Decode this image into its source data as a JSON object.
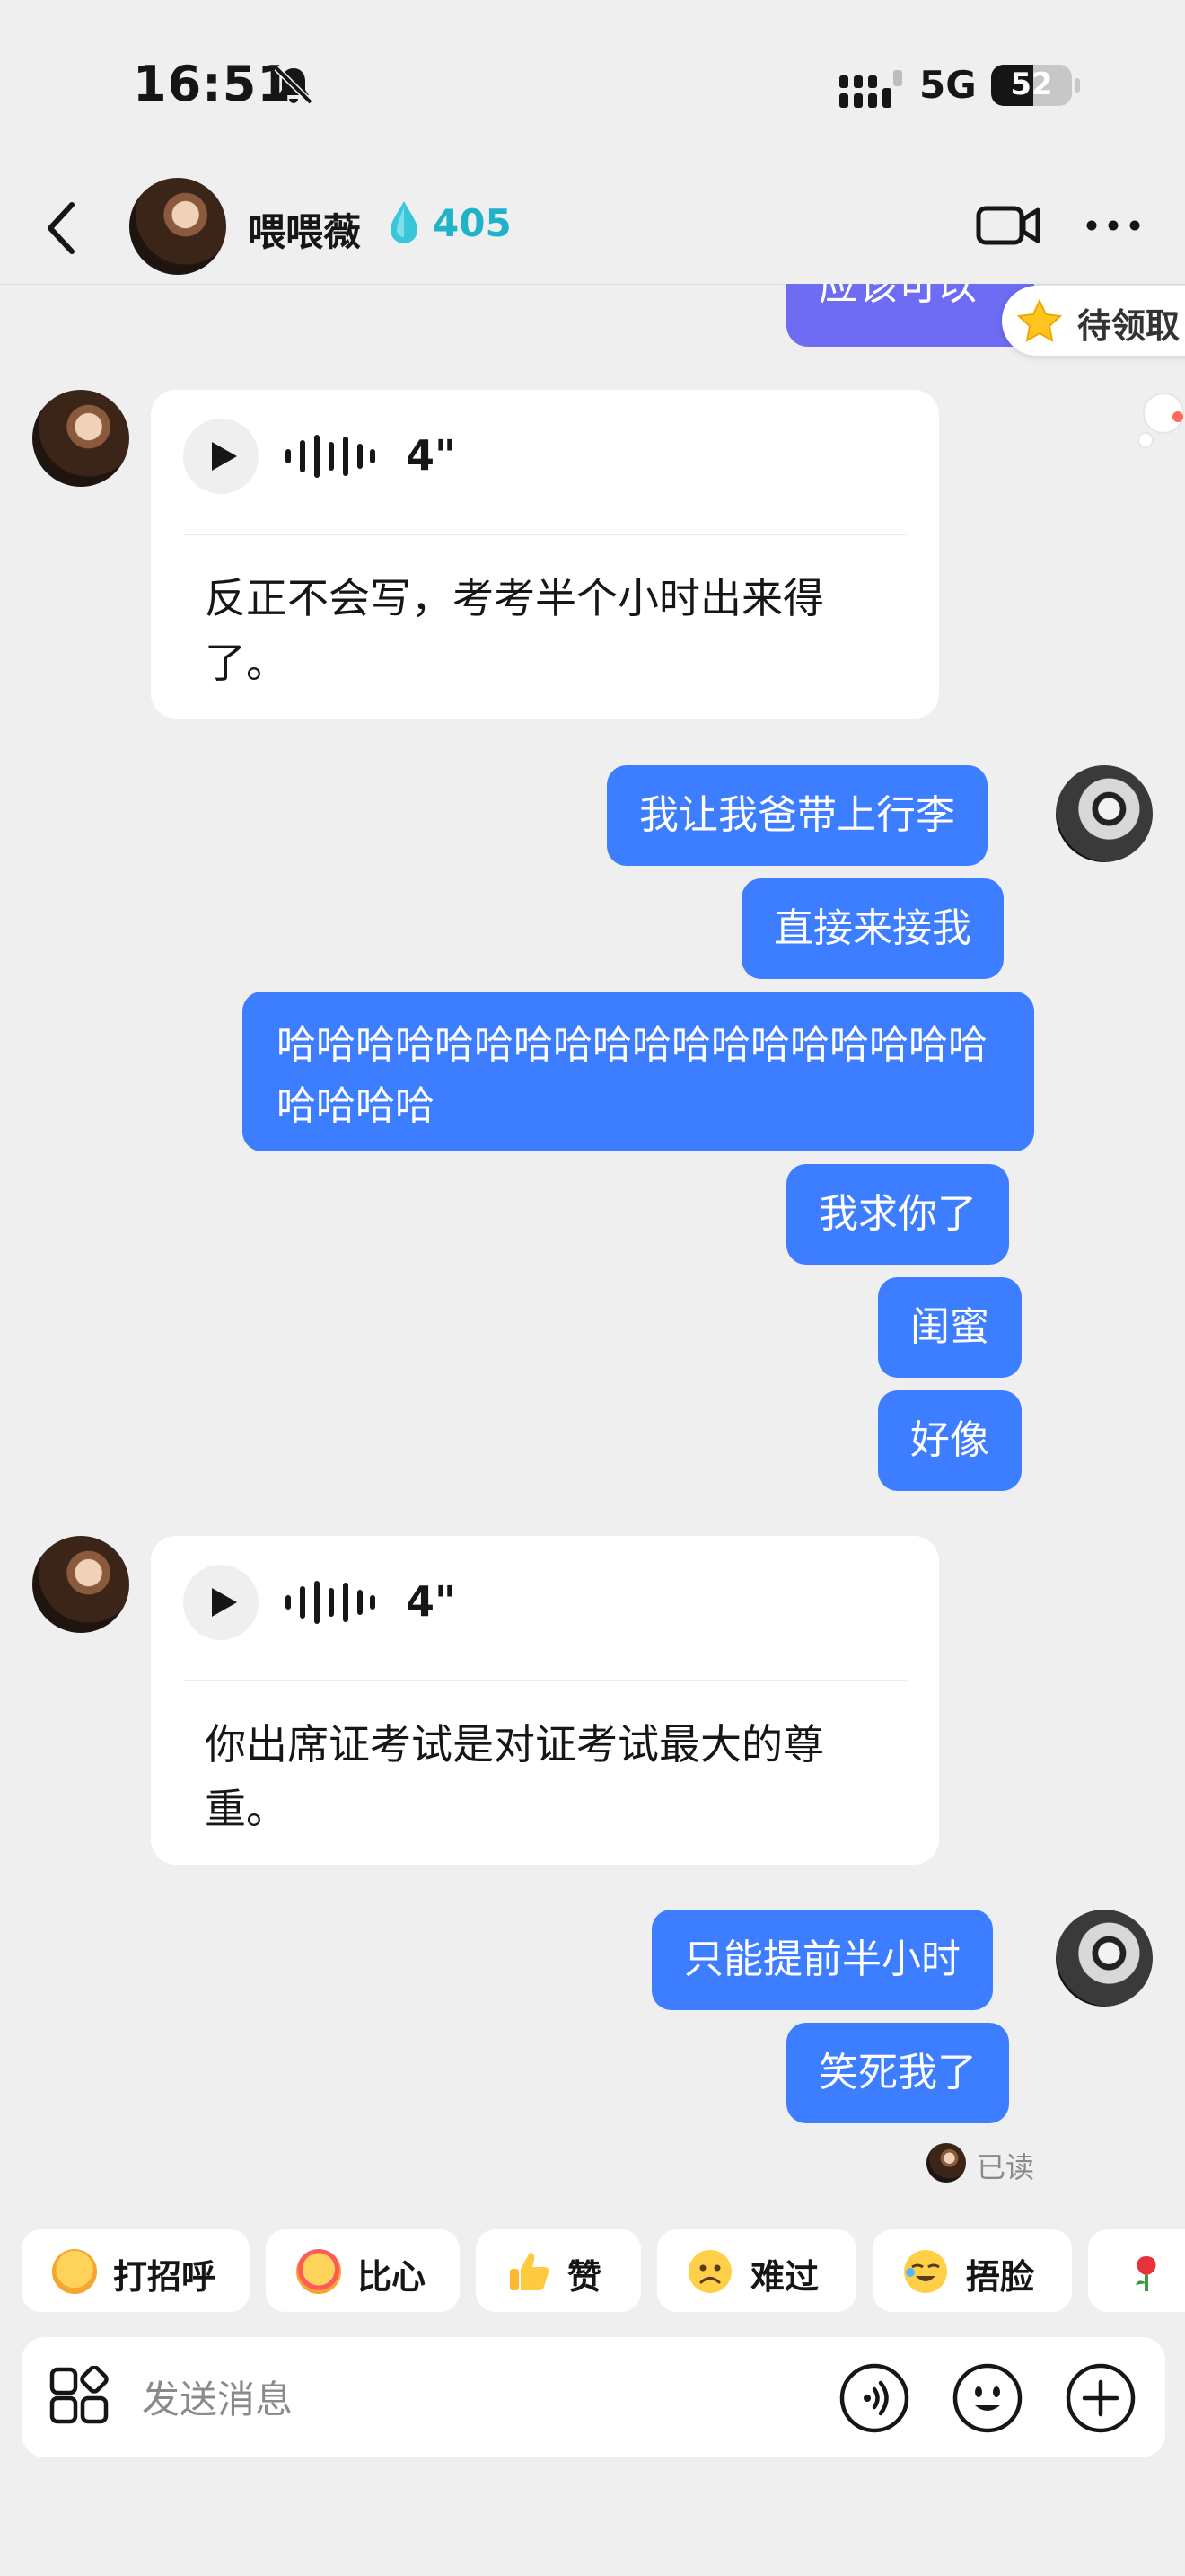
{
  "status_bar": {
    "time": "16:51",
    "network": "5G",
    "battery": "52",
    "battery_level": 0.52,
    "icons": [
      "bell-off-icon",
      "signal-icon"
    ]
  },
  "header": {
    "name": "喂喂薇",
    "score": "405",
    "score_icon": "water-drop-icon",
    "accent": "#1fb2c9",
    "icons": [
      "back-icon",
      "video-call-icon",
      "more-icon"
    ]
  },
  "colors": {
    "outgoing_bubble": "#3d7dff",
    "incoming_card": "#ffffff",
    "background": "#efefef"
  },
  "messages": {
    "partial": "应该可以",
    "pending_badge": "待领取",
    "voice1": {
      "duration": "4\"",
      "text": "反正不会写，考考半个小时出来得了。"
    },
    "group1": [
      "我让我爸带上行李",
      "直接来接我",
      "哈哈哈哈哈哈哈哈哈哈哈哈哈哈哈哈哈哈哈哈哈哈",
      "我求你了",
      "闺蜜",
      "好像"
    ],
    "voice2": {
      "duration": "4\"",
      "text": "你出席证考试是对证考试最大的尊重。"
    },
    "group2": [
      "只能提前半小时",
      "笑死我了"
    ],
    "read_status": "已读"
  },
  "quick_replies": [
    {
      "label": "打招呼",
      "icon": "wave-hello-emoji-icon"
    },
    {
      "label": "比心",
      "icon": "heart-hands-emoji-icon"
    },
    {
      "label": "赞",
      "icon": "thumbs-up-icon"
    },
    {
      "label": "难过",
      "icon": "sad-face-icon"
    },
    {
      "label": "捂脸",
      "icon": "facepalm-emoji-icon"
    }
  ],
  "composer": {
    "placeholder": "发送消息",
    "icons": [
      "apps-icon",
      "voice-input-icon",
      "emoji-icon",
      "plus-icon"
    ]
  }
}
